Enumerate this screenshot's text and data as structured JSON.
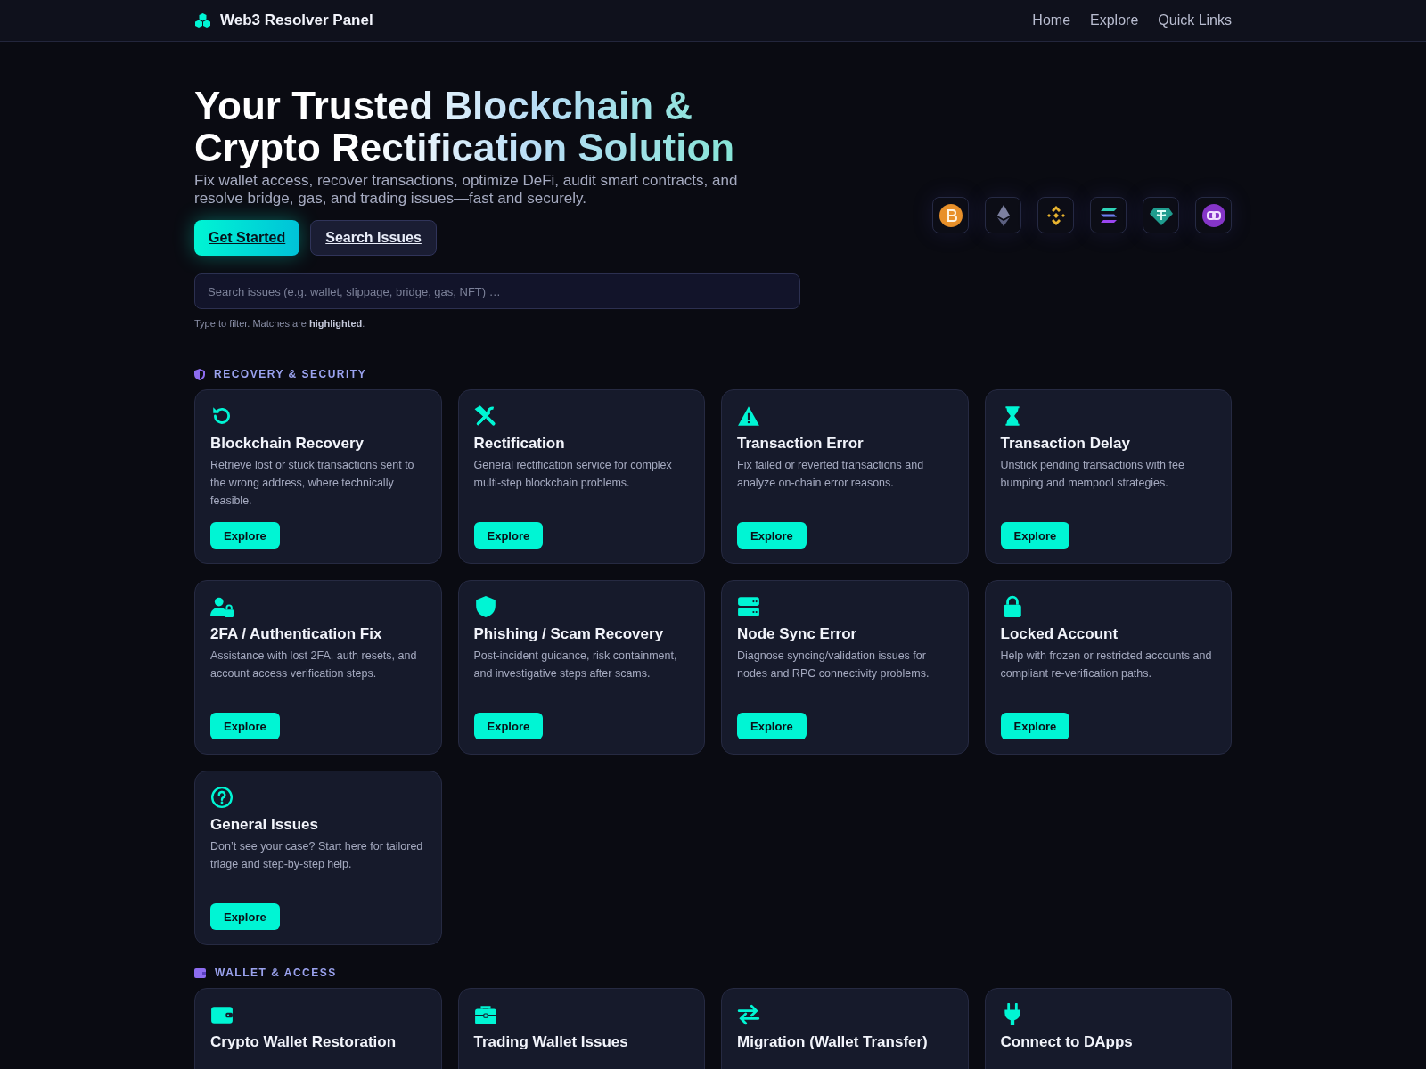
{
  "nav": {
    "brand": "Web3 Resolver Panel",
    "links": [
      "Home",
      "Explore",
      "Quick Links"
    ]
  },
  "hero": {
    "title": "Your Trusted Blockchain & Crypto Rectification Solution",
    "subtitle": "Fix wallet access, recover transactions, optimize DeFi, audit smart contracts, and resolve bridge, gas, and trading issues—fast and securely.",
    "buttons": [
      {
        "label": "Get Started",
        "kind": "primary"
      },
      {
        "label": "Search Issues",
        "kind": "secondary"
      }
    ],
    "search": {
      "placeholder": "Search issues (e.g. wallet, slippage, bridge, gas, NFT) …"
    },
    "hint": "Type to filter. Matches are **highlighted**."
  },
  "sections": [
    {
      "title": "RECOVERY & SECURITY",
      "cards": [
        {
          "title": "Blockchain Recovery",
          "text": "Retrieve lost or stuck transactions sent to the wrong address, where technically feasible.",
          "button": "Explore"
        },
        {
          "title": "Rectification",
          "text": "General rectification service for complex multi-step blockchain problems.",
          "button": "Explore"
        },
        {
          "title": "Transaction Error",
          "text": "Fix failed or reverted transactions and analyze on-chain error reasons.",
          "button": "Explore"
        },
        {
          "title": "Transaction Delay",
          "text": "Unstick pending transactions with fee bumping and mempool strategies.",
          "button": "Explore"
        },
        {
          "title": "2FA / Authentication Fix",
          "text": "Assistance with lost 2FA, auth resets, and account access verification steps.",
          "button": "Explore"
        },
        {
          "title": "Phishing / Scam Recovery",
          "text": "Post-incident guidance, risk containment, and investigative steps after scams.",
          "button": "Explore"
        },
        {
          "title": "Node Sync Error",
          "text": "Diagnose syncing/validation issues for nodes and RPC connectivity problems.",
          "button": "Explore"
        },
        {
          "title": "Locked Account",
          "text": "Help with frozen or restricted accounts and compliant re-verification paths.",
          "button": "Explore"
        },
        {
          "title": "General Issues",
          "text": "Don’t see your case? Start here for tailored triage and step-by-step help.",
          "button": "Explore"
        }
      ]
    },
    {
      "title": "WALLET & ACCESS",
      "cards": [
        {
          "title": "Crypto Wallet Restoration"
        },
        {
          "title": "Trading Wallet Issues"
        },
        {
          "title": "Migration (Wallet Transfer)"
        },
        {
          "title": "Connect to DApps"
        }
      ]
    }
  ]
}
